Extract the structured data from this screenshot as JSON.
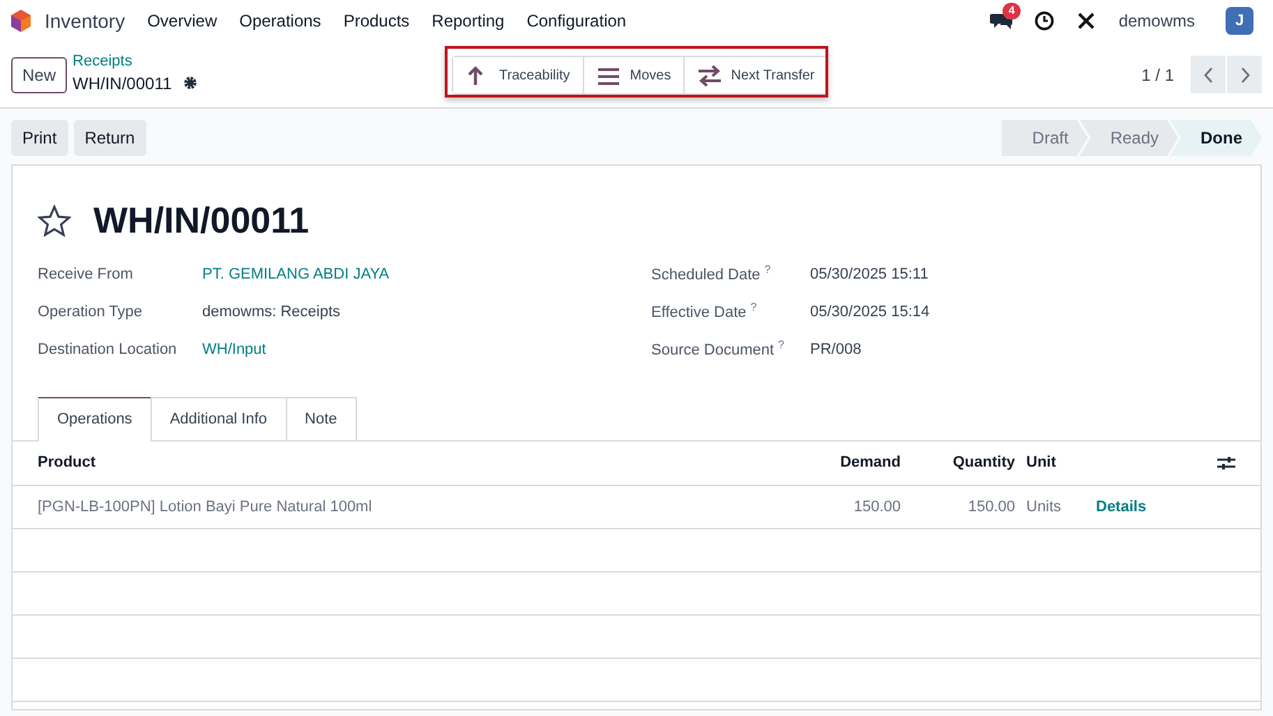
{
  "navbar": {
    "app": "Inventory",
    "menu": [
      "Overview",
      "Operations",
      "Products",
      "Reporting",
      "Configuration"
    ],
    "message_count": "4",
    "user": "demowms",
    "avatar": "J"
  },
  "control_panel": {
    "new_button": "New",
    "breadcrumb": "Receipts",
    "record": "WH/IN/00011",
    "smart_buttons_highlighted": true,
    "smart_buttons": [
      {
        "kind": "up",
        "label": "Traceability"
      },
      {
        "kind": "list",
        "label": "Moves"
      },
      {
        "kind": "transfer",
        "label": "Next Transfer"
      }
    ],
    "pager": "1 / 1"
  },
  "actions": [
    "Print",
    "Return"
  ],
  "stages": [
    {
      "label": "Draft",
      "selected": false
    },
    {
      "label": "Ready",
      "selected": false
    },
    {
      "label": "Done",
      "selected": true
    }
  ],
  "form": {
    "title": "WH/IN/00011",
    "starred": false,
    "left_fields": [
      {
        "label": "Receive From",
        "value": "PT. GEMILANG ABDI JAYA",
        "kind": "link"
      },
      {
        "label": "Operation Type",
        "value": "demowms: Receipts",
        "kind": "text"
      },
      {
        "label": "Destination Location",
        "value": "WH/Input",
        "kind": "link"
      }
    ],
    "right_fields": [
      {
        "label": "Scheduled Date",
        "help": "?",
        "value": "05/30/2025 15:11"
      },
      {
        "label": "Effective Date",
        "help": "?",
        "value": "05/30/2025 15:14"
      },
      {
        "label": "Source Document",
        "help": "?",
        "value": "PR/008"
      }
    ],
    "tabs": [
      {
        "label": "Operations",
        "selected": true
      },
      {
        "label": "Additional Info",
        "selected": false
      },
      {
        "label": "Note",
        "selected": false
      }
    ],
    "table": {
      "columns": [
        "Product",
        "Demand",
        "Quantity",
        "Unit"
      ],
      "rows": [
        {
          "product": "[PGN-LB-100PN] Lotion Bayi Pure Natural 100ml",
          "demand": "150.00",
          "quantity": "150.00",
          "unit": "Units",
          "action": "Details"
        }
      ]
    }
  }
}
